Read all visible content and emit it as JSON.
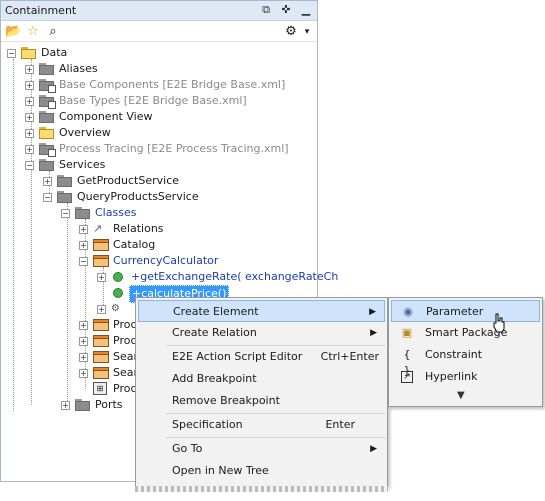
{
  "panel": {
    "title": "Containment"
  },
  "tree": {
    "nodes": [
      {
        "label": "Data"
      },
      {
        "label": "Aliases"
      },
      {
        "label": "Base Components [E2E Bridge Base.xml]"
      },
      {
        "label": "Base Types [E2E Bridge Base.xml]"
      },
      {
        "label": "Component View"
      },
      {
        "label": "Overview"
      },
      {
        "label": "Process Tracing [E2E Process Tracing.xml]"
      },
      {
        "label": "Services"
      },
      {
        "label": "GetProductService"
      },
      {
        "label": "QueryProductsService"
      },
      {
        "label": "Classes"
      },
      {
        "label": "Relations"
      },
      {
        "label": "Catalog"
      },
      {
        "label": "CurrencyCalculator"
      },
      {
        "label": "+getExchangeRate( exchangeRateCh"
      },
      {
        "label": "+calculatePrice()"
      },
      {
        "label": "Proc"
      },
      {
        "label": "Proc"
      },
      {
        "label": "Sear"
      },
      {
        "label": "Sear"
      },
      {
        "label": "Proc"
      },
      {
        "label": "Ports"
      }
    ]
  },
  "context_menu": {
    "items": [
      {
        "label": "Create Element",
        "has_submenu": true
      },
      {
        "label": "Create Relation",
        "has_submenu": true
      },
      {
        "label": "E2E Action Script Editor",
        "shortcut": "Ctrl+Enter"
      },
      {
        "label": "Add Breakpoint"
      },
      {
        "label": "Remove Breakpoint"
      },
      {
        "label": "Specification",
        "shortcut": "Enter"
      },
      {
        "label": "Go To",
        "has_submenu": true
      },
      {
        "label": "Open in New Tree"
      }
    ]
  },
  "submenu": {
    "items": [
      {
        "label": "Parameter"
      },
      {
        "label": "Smart Package"
      },
      {
        "label": "Constraint"
      },
      {
        "label": "Hyperlink"
      }
    ]
  },
  "colors": {
    "selection": "#3399ff",
    "menu_highlight": "#cfe4fb",
    "titlebar": "#dfe9f5",
    "link_blue": "#1a3ea8",
    "muted_grey": "#8a8a8a"
  }
}
